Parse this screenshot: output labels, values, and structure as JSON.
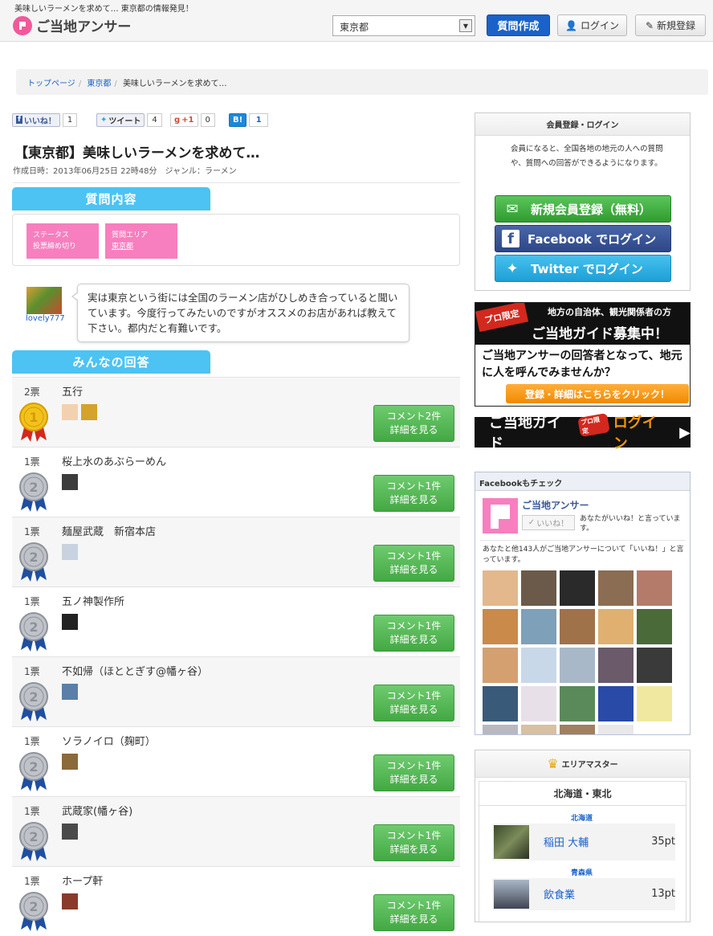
{
  "header": {
    "tagline": "美味しいラーメンを求めて… 東京都の情報発見！",
    "logo_text": "ご当地アンサー",
    "prefecture_select": "東京都",
    "ask_button": "質問作成",
    "login_button": "ログイン",
    "signup_button": "新規登録"
  },
  "breadcrumb": {
    "items": [
      "トップページ",
      "東京都"
    ],
    "current": "美味しいラーメンを求めて…"
  },
  "social": {
    "like_label": "いいね！",
    "like_count": "1",
    "tweet_label": "ツイート",
    "tweet_count": "4",
    "gplus_label": "+1",
    "gplus_count": "0",
    "hatena_label": "B!",
    "hatena_count": "1"
  },
  "question": {
    "title": "【東京都】美味しいラーメンを求めて…",
    "meta": "作成日時：2013年06月25日 22時48分　ジャンル：ラーメン",
    "section_label": "質問内容",
    "status_label": "ステータス",
    "status_value": "投票締め切り",
    "area_label": "質問エリア",
    "area_value": "東京都",
    "asker_name": "lovely777",
    "body": "実は東京という街には全国のラーメン店がひしめき合っていると聞いています。今度行ってみたいのですがオススメのお店があれば教えて下さい。都内だと有難いです。"
  },
  "answers": {
    "section_label": "みんなの回答",
    "items": [
      {
        "votes": "2票",
        "name": "五行",
        "comment_count": "コメント2件",
        "detail": "詳細を見る",
        "medal": "gold"
      },
      {
        "votes": "1票",
        "name": "桜上水のあぶらーめん",
        "comment_count": "コメント1件",
        "detail": "詳細を見る",
        "medal": "silver"
      },
      {
        "votes": "1票",
        "name": "麺屋武蔵　新宿本店",
        "comment_count": "コメント1件",
        "detail": "詳細を見る",
        "medal": "silver"
      },
      {
        "votes": "1票",
        "name": "五ノ神製作所",
        "comment_count": "コメント1件",
        "detail": "詳細を見る",
        "medal": "silver"
      },
      {
        "votes": "1票",
        "name": "不如帰（ほととぎす@幡ヶ谷）",
        "comment_count": "コメント1件",
        "detail": "詳細を見る",
        "medal": "silver"
      },
      {
        "votes": "1票",
        "name": "ソラノイロ（麹町）",
        "comment_count": "コメント1件",
        "detail": "詳細を見る",
        "medal": "silver"
      },
      {
        "votes": "1票",
        "name": "武蔵家(幡ヶ谷)",
        "comment_count": "コメント1件",
        "detail": "詳細を見る",
        "medal": "silver"
      },
      {
        "votes": "1票",
        "name": "ホープ軒",
        "comment_count": "コメント1件",
        "detail": "詳細を見る",
        "medal": "silver"
      }
    ]
  },
  "sidebar": {
    "member_head": "会員登録・ログイン",
    "member_text": "会員になると、全国各地の地元の人への質問や、質問への回答ができるようになります。",
    "register_button": "新規会員登録（無料）",
    "facebook_button": "Facebook でログイン",
    "twitter_button": "Twitter でログイン",
    "guide_badge": "プロ限定",
    "guide_line1": "地方の自治体、観光関係者の方",
    "guide_line2": "ご当地ガイド募集中！",
    "guide_line3": "ご当地アンサーの回答者となって、地元に人を呼んでみませんか？",
    "guide_cta": "登録・詳細はこちらをクリック！",
    "login_banner_a": "ご当地ガイド",
    "login_banner_b": "ログイン",
    "login_banner_badge": "プロ限定",
    "fb_head": "Facebookもチェック",
    "fb_page_name": "ご当地アンサー",
    "fb_like": "いいね！",
    "fb_liked_text": "あなたがいいね！と言っています。",
    "fb_fans_text": "あなたと他143人がご当地アンサーについて「いいね！」と言っています。",
    "master_head": "エリアマスター",
    "master_region": "北海道・東北",
    "masters": [
      {
        "pref": "北海道",
        "name": "稲田 大輔",
        "points": "35pt"
      },
      {
        "pref": "青森県",
        "name": "飲食業",
        "points": "13pt"
      }
    ]
  },
  "colors": {
    "accent_blue": "#1a62c9",
    "section_cyan": "#4cc3f3",
    "pink": "#f77fbf",
    "green_button": "#43a843"
  }
}
